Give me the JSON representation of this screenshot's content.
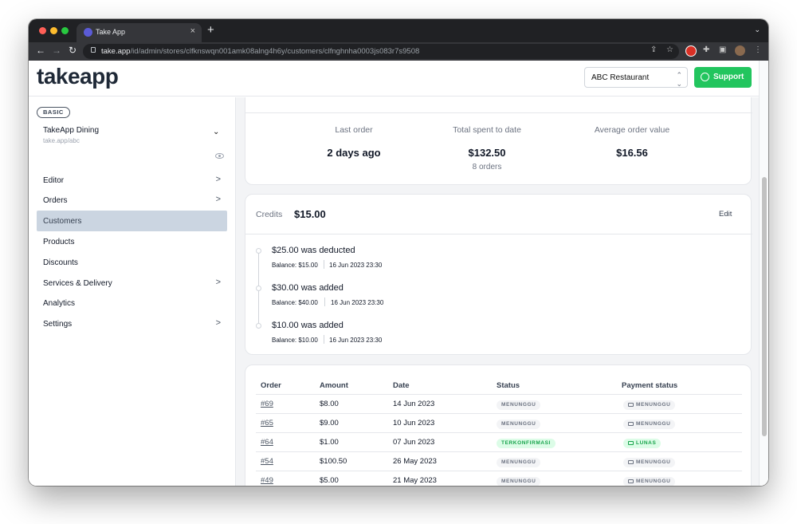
{
  "browser": {
    "tab_title": "Take App",
    "tab_close": "×",
    "new_tab": "+",
    "url_host": "take.app",
    "url_path": "/id/admin/stores/clfknswqn001amk08alng4h6y/customers/clfnghnha0003js083r7s9508"
  },
  "header": {
    "logo": "takeapp",
    "store_selected": "ABC Restaurant",
    "support_label": "Support"
  },
  "sidebar": {
    "plan": "BASIC",
    "store_name": "TakeApp Dining",
    "store_url": "take.app/abc",
    "items": [
      {
        "label": "Editor",
        "chevron": ">"
      },
      {
        "label": "Orders",
        "chevron": ">"
      },
      {
        "label": "Customers",
        "chevron": ""
      },
      {
        "label": "Products",
        "chevron": ""
      },
      {
        "label": "Discounts",
        "chevron": ""
      },
      {
        "label": "Services & Delivery",
        "chevron": ">"
      },
      {
        "label": "Analytics",
        "chevron": ""
      },
      {
        "label": "Settings",
        "chevron": ">"
      }
    ]
  },
  "stats": {
    "last_order_label": "Last order",
    "last_order_value": "2 days ago",
    "total_spent_label": "Total spent to date",
    "total_spent_value": "$132.50",
    "total_orders": "8 orders",
    "avg_label": "Average order value",
    "avg_value": "$16.56"
  },
  "credits": {
    "label": "Credits",
    "value": "$15.00",
    "edit": "Edit",
    "history": [
      {
        "title": "$25.00 was deducted",
        "balance": "Balance: $15.00",
        "date": "16 Jun 2023 23:30"
      },
      {
        "title": "$30.00 was added",
        "balance": "Balance: $40.00",
        "date": "16 Jun 2023 23:30"
      },
      {
        "title": "$10.00 was added",
        "balance": "Balance: $10.00",
        "date": "16 Jun 2023 23:30"
      }
    ]
  },
  "orders": {
    "columns": [
      "Order",
      "Amount",
      "Date",
      "Status",
      "Payment status"
    ],
    "rows": [
      {
        "order": "#69",
        "amount": "$8.00",
        "date": "14 Jun 2023",
        "status": "MENUNGGU",
        "payment": "MENUNGGU"
      },
      {
        "order": "#65",
        "amount": "$9.00",
        "date": "10 Jun 2023",
        "status": "MENUNGGU",
        "payment": "MENUNGGU"
      },
      {
        "order": "#64",
        "amount": "$1.00",
        "date": "07 Jun 2023",
        "status": "TERKONFIRMASI",
        "payment": "LUNAS"
      },
      {
        "order": "#54",
        "amount": "$100.50",
        "date": "26 May 2023",
        "status": "MENUNGGU",
        "payment": "MENUNGGU"
      },
      {
        "order": "#49",
        "amount": "$5.00",
        "date": "21 May 2023",
        "status": "MENUNGGU",
        "payment": "MENUNGGU"
      }
    ]
  },
  "colors": {
    "accent_green": "#22c55e",
    "sidebar_active": "#cbd5e1",
    "badge_green": "#16a34a"
  }
}
